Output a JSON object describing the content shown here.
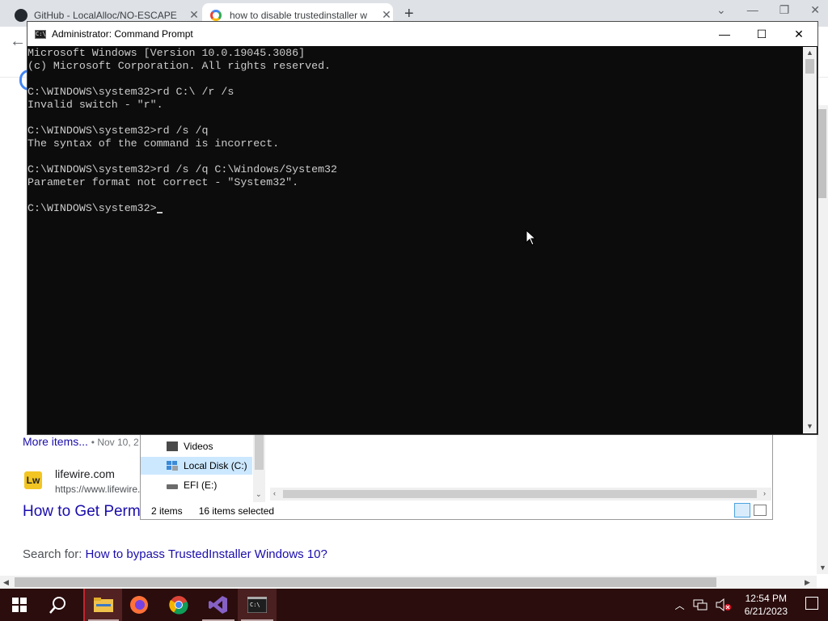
{
  "browser": {
    "tabs": [
      {
        "title": "GitHub - LocalAlloc/NO-ESCAPE",
        "close": "✕"
      },
      {
        "title": "how to disable trustedinstaller w",
        "close": "✕"
      }
    ],
    "new_tab": "+",
    "controls": {
      "minimize": "—",
      "restore": "❐",
      "close": "✕"
    }
  },
  "web": {
    "more_items": "More items...",
    "more_items_date": "• Nov 10, 2",
    "result_site": "lifewire.com",
    "result_url": "https://www.lifewire.",
    "result_title": "How to Get Perm",
    "search_for_prefix": "Search for:",
    "search_for_link": "How to bypass TrustedInstaller Windows 10?"
  },
  "explorer": {
    "nav_items": [
      {
        "label": "Videos",
        "icon": "videos-folder-icon"
      },
      {
        "label": "Local Disk (C:)",
        "icon": "local-disk-icon",
        "selected": true
      },
      {
        "label": "EFI (E:)",
        "icon": "drive-icon"
      }
    ],
    "status_count": "2 items",
    "status_selected": "16 items selected"
  },
  "cmd": {
    "title": "Administrator: Command Prompt",
    "icon_text": "C:\\",
    "controls": {
      "minimize": "—",
      "maximize": "☐",
      "close": "✕"
    },
    "lines": [
      "Microsoft Windows [Version 10.0.19045.3086]",
      "(c) Microsoft Corporation. All rights reserved.",
      "",
      "C:\\WINDOWS\\system32>rd C:\\ /r /s",
      "Invalid switch - \"r\".",
      "",
      "C:\\WINDOWS\\system32>rd /s /q",
      "The syntax of the command is incorrect.",
      "",
      "C:\\WINDOWS\\system32>rd /s /q C:\\Windows/System32",
      "Parameter format not correct - \"System32\".",
      "",
      "C:\\WINDOWS\\system32>"
    ]
  },
  "taskbar": {
    "apps": [
      "windows-start",
      "search",
      "file-explorer",
      "firefox",
      "chrome",
      "visual-studio",
      "command-prompt"
    ],
    "time": "12:54 PM",
    "date": "6/21/2023"
  },
  "colors": {
    "console_bg": "#0c0c0c",
    "console_text": "#cccccc",
    "taskbar_bg": "#2b0d0d",
    "link": "#1a0dab"
  }
}
